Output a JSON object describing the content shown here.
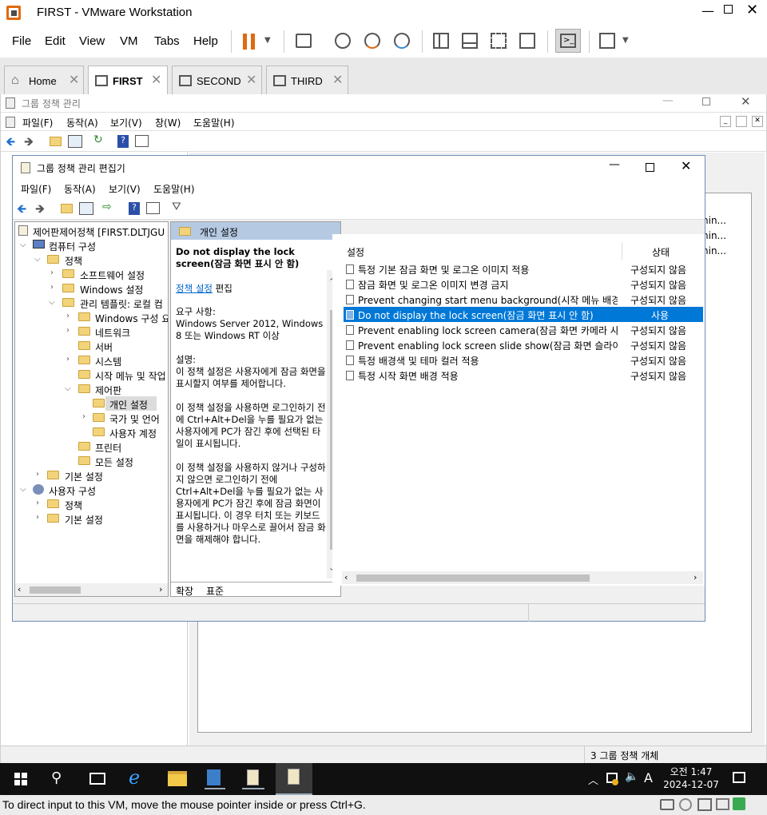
{
  "vm": {
    "title": "FIRST - VMware Workstation",
    "menu": [
      "File",
      "Edit",
      "View",
      "VM",
      "Tabs",
      "Help"
    ],
    "tabs": [
      {
        "label": "Home"
      },
      {
        "label": "FIRST"
      },
      {
        "label": "SECOND"
      },
      {
        "label": "THIRD"
      }
    ],
    "status": "To direct input to this VM, move the mouse pointer inside or press Ctrl+G."
  },
  "gpmc": {
    "title": "그룹 정책 관리",
    "menu": [
      "파일(F)",
      "동작(A)",
      "보기(V)",
      "창(W)",
      "도움말(H)"
    ],
    "right_items": [
      "nin...",
      "nin...",
      "nin..."
    ],
    "status": "3 그룹 정책 개체"
  },
  "editor": {
    "title": "그룹 정책 관리 편집기",
    "menu": [
      "파일(F)",
      "동작(A)",
      "보기(V)",
      "도움말(H)"
    ],
    "tree": {
      "root": "제어판제어정책 [FIRST.DLTJGU",
      "computer": "컴퓨터 구성",
      "policy": "정책",
      "software": "소프트웨어 설정",
      "windows": "Windows 설정",
      "admin": "관리 템플릿: 로컬 컴",
      "wincomp": "Windows 구성 요",
      "network": "네트워크",
      "server": "서버",
      "system": "시스템",
      "startmenu": "시작 메뉴 및 작업",
      "control": "제어판",
      "personal": "개인 설정",
      "region": "국가 및 언어",
      "useraccount": "사용자 계정",
      "printer": "프린터",
      "allsettings": "모든 설정",
      "basic": "기본 설정",
      "user": "사용자 구성",
      "upolicy": "정책",
      "ubasic": "기본 설정"
    },
    "header": "개인 설정",
    "desc": {
      "title": "Do not display the lock screen(잠금 화면 표시 안 함)",
      "link": "정책 설정",
      "edit": "편집",
      "req_label": "요구 사항:",
      "req": "Windows Server 2012, Windows 8 또는 Windows RT 이상",
      "desc_label": "설명:",
      "p1": "이 정책 설정은 사용자에게 잠금 화면을 표시할지 여부를 제어합니다.",
      "p2": "이 정책 설정을 사용하면 로그인하기 전에 Ctrl+Alt+Del을 누를 필요가 없는 사용자에게 PC가 잠긴 후에 선택된 타일이 표시됩니다.",
      "p3": "이 정책 설정을 사용하지 않거나 구성하지 않으면 로그인하기 전에 Ctrl+Alt+Del을 누를 필요가 없는 사용자에게 PC가 잠긴 후에 잠금 화면이 표시됩니다. 이 경우 터치 또는 키보드를 사용하거나 마우스로 끌어서 잠금 화면을 해제해야 합니다."
    },
    "cols": {
      "setting": "설정",
      "state": "상태"
    },
    "rows": [
      {
        "name": "특정 기본 잠금 화면 및 로그온 이미지 적용",
        "state": "구성되지 않음"
      },
      {
        "name": "잠금 화면 및 로그온 이미지 변경 금지",
        "state": "구성되지 않음"
      },
      {
        "name": "Prevent changing start menu background(시작 메뉴 배경 ...",
        "state": "구성되지 않음"
      },
      {
        "name": "Do not display the lock screen(잠금 화면 표시 안 함)",
        "state": "사용"
      },
      {
        "name": "Prevent enabling lock screen camera(잠금 화면 카메라 사...",
        "state": "구성되지 않음"
      },
      {
        "name": "Prevent enabling lock screen slide show(잠금 화면 슬라이...",
        "state": "구성되지 않음"
      },
      {
        "name": "특정 배경색 및 테마 컬러 적용",
        "state": "구성되지 않음"
      },
      {
        "name": "특정 시작 화면 배경 적용",
        "state": "구성되지 않음"
      }
    ],
    "tabs": [
      "확장",
      "표준"
    ]
  },
  "taskbar": {
    "ime": "A",
    "time": "오전 1:47",
    "date": "2024-12-07"
  }
}
